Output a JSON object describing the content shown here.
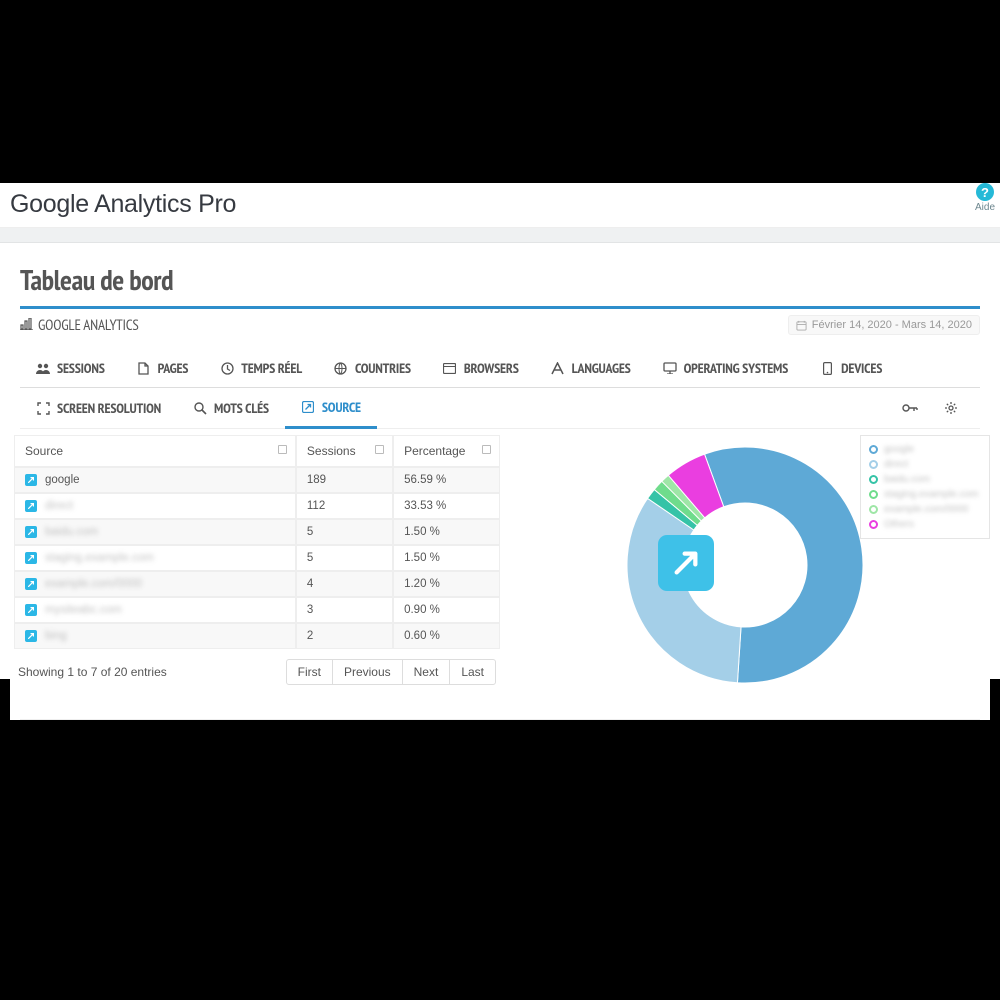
{
  "header": {
    "title": "Google Analytics Pro",
    "help_label": "Aide"
  },
  "panel": {
    "title": "Tableau de bord",
    "subtitle": "GOOGLE ANALYTICS",
    "date_range": "Février 14, 2020 - Mars 14, 2020"
  },
  "tabs": {
    "row1": [
      "SESSIONS",
      "PAGES",
      "TEMPS RÉEL",
      "COUNTRIES",
      "BROWSERS",
      "LANGUAGES",
      "OPERATING SYSTEMS",
      "DEVICES"
    ],
    "row2": [
      "SCREEN RESOLUTION",
      "MOTS CLÉS",
      "SOURCE"
    ],
    "active": "SOURCE"
  },
  "table": {
    "headers": [
      "Source",
      "Sessions",
      "Percentage"
    ],
    "rows": [
      {
        "source": "google",
        "blur": false,
        "sessions": "189",
        "pct": "56.59 %"
      },
      {
        "source": "direct",
        "blur": true,
        "sessions": "112",
        "pct": "33.53 %"
      },
      {
        "source": "baidu.com",
        "blur": true,
        "sessions": "5",
        "pct": "1.50 %"
      },
      {
        "source": "staging.example.com",
        "blur": true,
        "sessions": "5",
        "pct": "1.50 %"
      },
      {
        "source": "example.com/0000",
        "blur": true,
        "sessions": "4",
        "pct": "1.20 %"
      },
      {
        "source": "mysiteabc.com",
        "blur": true,
        "sessions": "3",
        "pct": "0.90 %"
      },
      {
        "source": "bing",
        "blur": true,
        "sessions": "2",
        "pct": "0.60 %"
      }
    ],
    "footer_text": "Showing 1 to 7 of 20 entries",
    "pager": {
      "first": "First",
      "prev": "Previous",
      "next": "Next",
      "last": "Last"
    }
  },
  "chart_data": {
    "type": "pie",
    "title": "",
    "series": [
      {
        "name": "google",
        "value": 56.59,
        "color": "#5ea9d6"
      },
      {
        "name": "direct",
        "value": 33.53,
        "color": "#a4cfe8"
      },
      {
        "name": "baidu.com",
        "value": 1.5,
        "color": "#35c3a7"
      },
      {
        "name": "staging.example.com",
        "value": 1.5,
        "color": "#6fdc8c"
      },
      {
        "name": "example.com/0000",
        "value": 1.2,
        "color": "#9ee6a6"
      },
      {
        "name": "Others",
        "value": 5.68,
        "color": "#ea3ee0"
      }
    ],
    "legend_colors": [
      "#5ea9d6",
      "#a4cfe8",
      "#35c3a7",
      "#6fdc8c",
      "#9ee6a6",
      "#ea3ee0"
    ]
  }
}
